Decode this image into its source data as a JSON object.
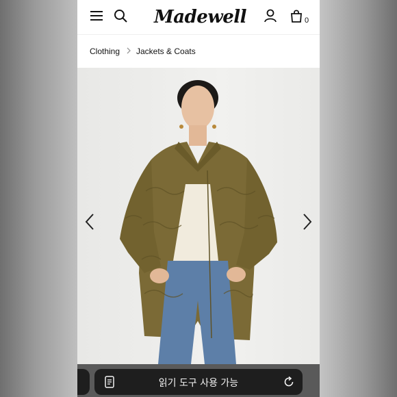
{
  "header": {
    "logo_text": "Madewell",
    "bag_count": "0",
    "icons": [
      "menu-icon",
      "search-icon",
      "account-icon",
      "shopping-bag-icon"
    ]
  },
  "breadcrumb": {
    "items": [
      "Clothing",
      "Jackets & Coats"
    ]
  },
  "product_image": {
    "jacket_color": "#7b6a36",
    "background": "#eeeeec"
  },
  "carousel": {
    "icons": [
      "chevron-left-icon",
      "chevron-right-icon"
    ]
  },
  "reader_bar": {
    "label": "읽기 도구 사용 가능",
    "icons": [
      "reader-mode-icon",
      "refresh-icon"
    ]
  }
}
